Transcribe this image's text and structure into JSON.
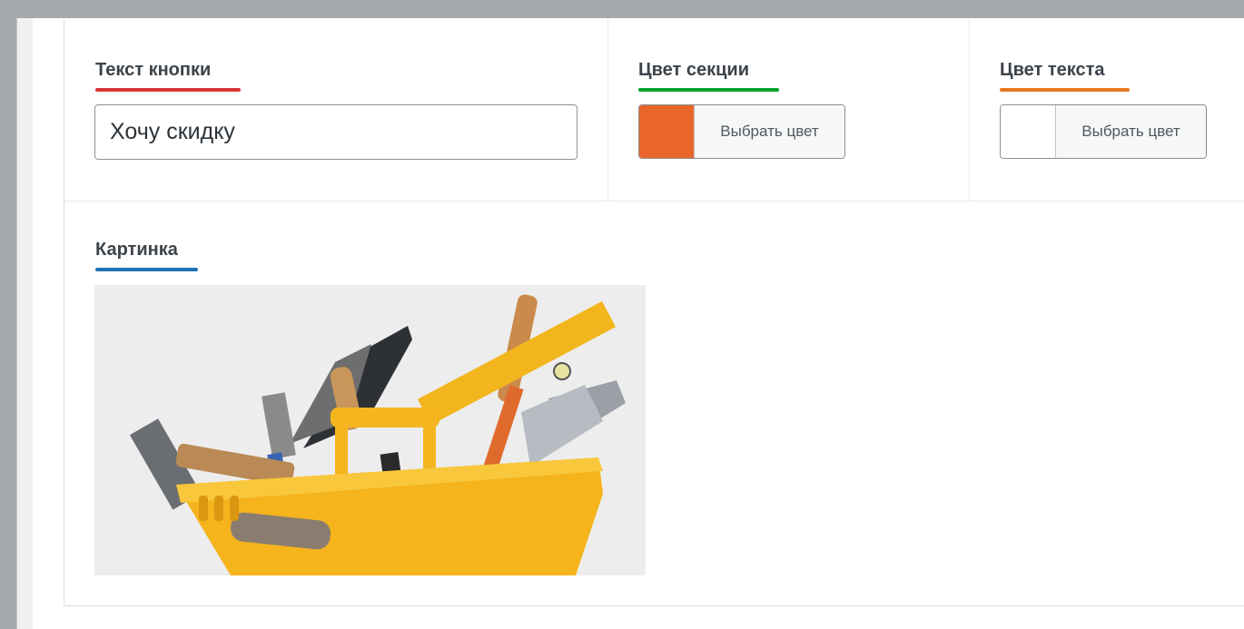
{
  "fields": {
    "button_text": {
      "label": "Текст кнопки",
      "value": "Хочу скидку"
    },
    "section_color": {
      "label": "Цвет секции",
      "button_label": "Выбрать цвет",
      "color": "#e8662a"
    },
    "text_color": {
      "label": "Цвет текста",
      "button_label": "Выбрать цвет",
      "color": "#ffffff"
    },
    "image": {
      "label": "Картинка"
    }
  },
  "accents": {
    "button_text": "#d63638",
    "section_color": "#00a32a",
    "text_color": "#e8761f",
    "image": "#2271b1"
  },
  "image_icon": "toolbox-image"
}
